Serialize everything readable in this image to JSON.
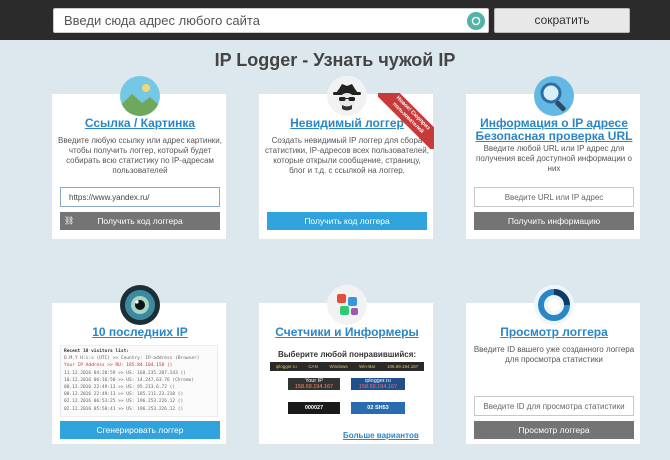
{
  "header": {
    "url_placeholder": "Введи сюда адрес любого сайта",
    "shorten_label": "сократить"
  },
  "page_title": "IP Logger - Узнать чужой IP",
  "cards": [
    {
      "title": "Ссылка / Картинка",
      "description": "Введите любую ссылку или адрес картинки, чтобы получить логгер, который будет собирать всю статистику по IP-адресам пользователей",
      "input_value": "https://www.yandex.ru/",
      "button": "Получить код логгера"
    },
    {
      "title": "Невидимый логгер",
      "ribbon": "Новое! Сюрприз пользователей",
      "description": "Создать невидимый IP логгер для сбора статистики, IP-адресов всех пользователей, которые открыли сообщение, страницу, блог и т.д. с ссылкой на логгер.",
      "button": "Получить код логгера"
    },
    {
      "title_line1": "Информация о IP адресе",
      "title_line2": "Безопасная проверка URL",
      "description": "Введите любой URL или IP адрес для получения всей доступной информации о них",
      "input_placeholder": "Введите URL или IP адрес",
      "button": "Получить информацию"
    },
    {
      "title": "10 последних IP",
      "visitors_header": "Recent 10 visitors list:",
      "visitors_columns": "D.M.Y H:i:s (UTC)  >> Country: IP-address (Browser)",
      "visitors_own": "Your IP Address      >> RU: 185.84.104.158 ()",
      "visitors_rows": [
        "11.12.2016 04:20:59 >> US: 168.235.207.143 ()",
        "10.12.2016 06:16:50 >> US: 14.247.63.76 (Chrome)",
        "08.12.2016 22:49:13 >> US: 95.213.6.72 ()",
        "08.12.2016 22:49:13 >> US: 185.211.23.210 ()",
        "02.12.2016 06:53:25 >> US: 196.253.226.12 ()",
        "02.12.2016 05:58:41 >> US: 196.253.226.12 ()"
      ],
      "button": "Сгенерировать логгер"
    },
    {
      "title": "Счетчики и Информеры",
      "subtitle": "Выберите любой понравившийся:",
      "strip": [
        "iplogger.ru",
        "CAN",
        "Windows",
        "Win-Bar",
        "106.69.194.167"
      ],
      "informers": [
        {
          "line1": "Your IP",
          "line2": "158.69.194.167"
        },
        {
          "line1": "iplogger.ru",
          "line2": "158.69.194.167"
        },
        {
          "line1": "000027",
          "line2": ""
        },
        {
          "line1": "02 SH53",
          "line2": ""
        }
      ],
      "more_link": "Больше вариантов"
    },
    {
      "title": "Просмотр логгера",
      "description": "Введите ID вашего уже созданного логгера для просмотра статистики",
      "input_placeholder": "Введите ID для просмотра статистики",
      "button": "Просмотр логгера"
    }
  ],
  "colors": {
    "topbar": "#2b2b2b",
    "background": "#dde8ee",
    "link": "#2a86c6",
    "button_grey": "#747474",
    "button_blue": "#30a3dc",
    "ribbon": "#c83a3a"
  }
}
